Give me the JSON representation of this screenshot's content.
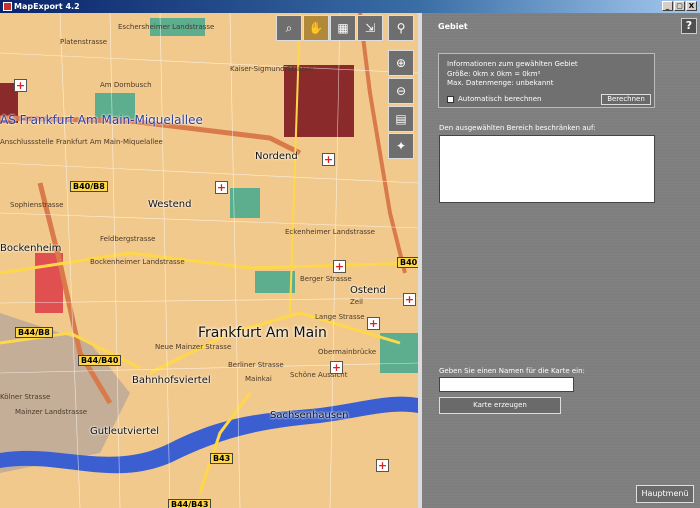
{
  "window": {
    "title": "MapExport 4.2",
    "minimize": "_",
    "maximize": "▢",
    "close": "X"
  },
  "map": {
    "streets": [
      "Platenstrasse",
      "Eschersheimer Landstrasse",
      "Am Dornbusch",
      "Kaiser-Sigmund-Strasse",
      "Anschlussstelle Frankfurt Am Main-Miquelallee",
      "Sophienstrasse",
      "Feldbergstrasse",
      "Bockenheimer Landstrasse",
      "Eckenheimer Landstrasse",
      "Berger Strasse",
      "Zeil",
      "Lange Strasse",
      "Obermainbrücke",
      "Neue Mainzer Strasse",
      "Berliner Strasse",
      "Mainkai",
      "Schöne Aussicht",
      "Kölner Strasse",
      "Mainzer Landstrasse",
      "Sachsenhausen"
    ],
    "highway_label": "AS Frankfurt Am Main-Miquelallee",
    "districts": [
      "Nordend",
      "Westend",
      "Bockenheim",
      "Ostend",
      "Bahnhofsviertel",
      "Gutleutviertel",
      "Sachsenhausen"
    ],
    "city": "Frankfurt Am Main",
    "roads": [
      "B40/B8",
      "B44/B8",
      "B44/B40",
      "B43",
      "B40",
      "B44/B43"
    ],
    "poi_symbol": "+",
    "tools": [
      "zoom-rect-icon",
      "pan-hand-icon",
      "select-rect-icon",
      "export-icon"
    ],
    "side_tools": [
      "search-icon",
      "zoom-in-icon",
      "zoom-out-icon",
      "overview-icon"
    ],
    "colors": {
      "land": "#f2c98c",
      "water": "#3b5fd0",
      "park": "#5cae8e",
      "highway": "#d87a4a",
      "urban": "#e89a70",
      "road": "#ffd84a"
    }
  },
  "panel": {
    "title": "Gebiet",
    "help": "?",
    "info_title": "Informationen zum gewählten Gebiet",
    "size": "Größe: 0km x 0km = 0km²",
    "data_volume": "Max. Datenmenge: unbekannt",
    "auto_calc": "Automatisch berechnen",
    "calc_button": "Berechnen",
    "restrict_label": "Den ausgewählten Bereich beschränken auf:",
    "name_label": "Geben Sie einen Namen für die Karte ein:",
    "name_value": "",
    "create_button": "Karte erzeugen",
    "main_menu": "Hauptmenü"
  }
}
